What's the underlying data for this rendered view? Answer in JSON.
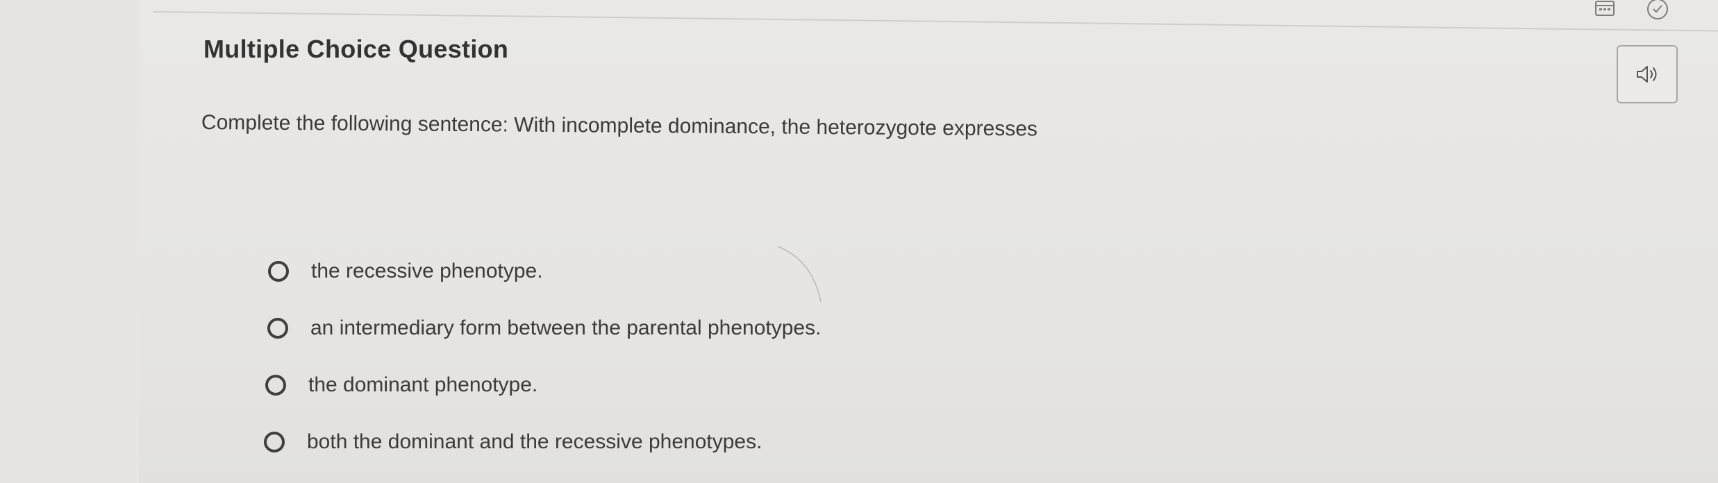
{
  "question": {
    "type_label": "Multiple Choice Question",
    "prompt": "Complete the following sentence: With incomplete dominance, the heterozygote expresses",
    "options": [
      {
        "label": "the recessive phenotype."
      },
      {
        "label": "an intermediary form between the parental phenotypes."
      },
      {
        "label": "the dominant phenotype."
      },
      {
        "label": "both the dominant and the recessive phenotypes."
      }
    ]
  },
  "toolbar": {
    "icons": [
      "calendar-icon",
      "check-circle-icon",
      "speaker-icon"
    ]
  },
  "colors": {
    "background": "#e2e1df",
    "text": "#3b3b3b",
    "radio_border": "#3f3f3f",
    "button_border": "#a6a6a6"
  }
}
